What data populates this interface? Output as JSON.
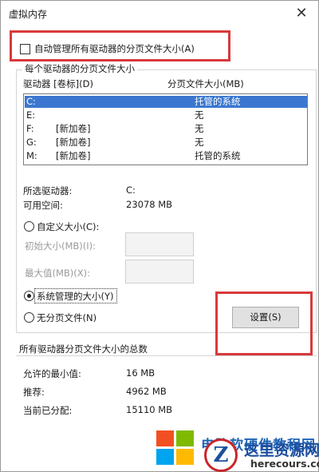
{
  "window": {
    "title": "虚拟内存",
    "close_glyph": "✕"
  },
  "auto_manage": {
    "label": "自动管理所有驱动器的分页文件大小(A)",
    "checked": false
  },
  "drives_group": {
    "legend": "每个驱动器的分页文件大小",
    "columns": {
      "drive": "驱动器 [卷标](D)",
      "size": "分页文件大小(MB)"
    },
    "rows": [
      {
        "drive": "C:",
        "label": "",
        "size": "托管的系统",
        "selected": true
      },
      {
        "drive": "E:",
        "label": "",
        "size": "无",
        "selected": false
      },
      {
        "drive": "F:",
        "label": "[新加卷]",
        "size": "无",
        "selected": false
      },
      {
        "drive": "G:",
        "label": "[新加卷]",
        "size": "无",
        "selected": false
      },
      {
        "drive": "M:",
        "label": "[新加卷]",
        "size": "托管的系统",
        "selected": false
      }
    ],
    "selected_drive_label": "所选驱动器:",
    "selected_drive_value": "C:",
    "free_space_label": "可用空间:",
    "free_space_value": "23078 MB",
    "custom_size_label": "自定义大小(C):",
    "initial_size_label": "初始大小(MB)(I):",
    "max_size_label": "最大值(MB)(X):",
    "system_managed_label": "系统管理的大小(Y)",
    "no_paging_label": "无分页文件(N)",
    "set_button": "设置(S)",
    "selected_option": "system_managed"
  },
  "totals": {
    "legend": "所有驱动器分页文件大小的总数",
    "min_label": "允许的最小值:",
    "min_value": "16 MB",
    "recommended_label": "推荐:",
    "recommended_value": "4962 MB",
    "current_label": "当前已分配:",
    "current_value": "15110 MB"
  },
  "watermark": {
    "blue_text": "电脑软硬件教程网",
    "logo_letter": "Z",
    "cn_text": "这里资源网",
    "en_text": "herecours.com"
  },
  "colors": {
    "selection": "#3b77d0",
    "highlight": "#d9393b"
  }
}
